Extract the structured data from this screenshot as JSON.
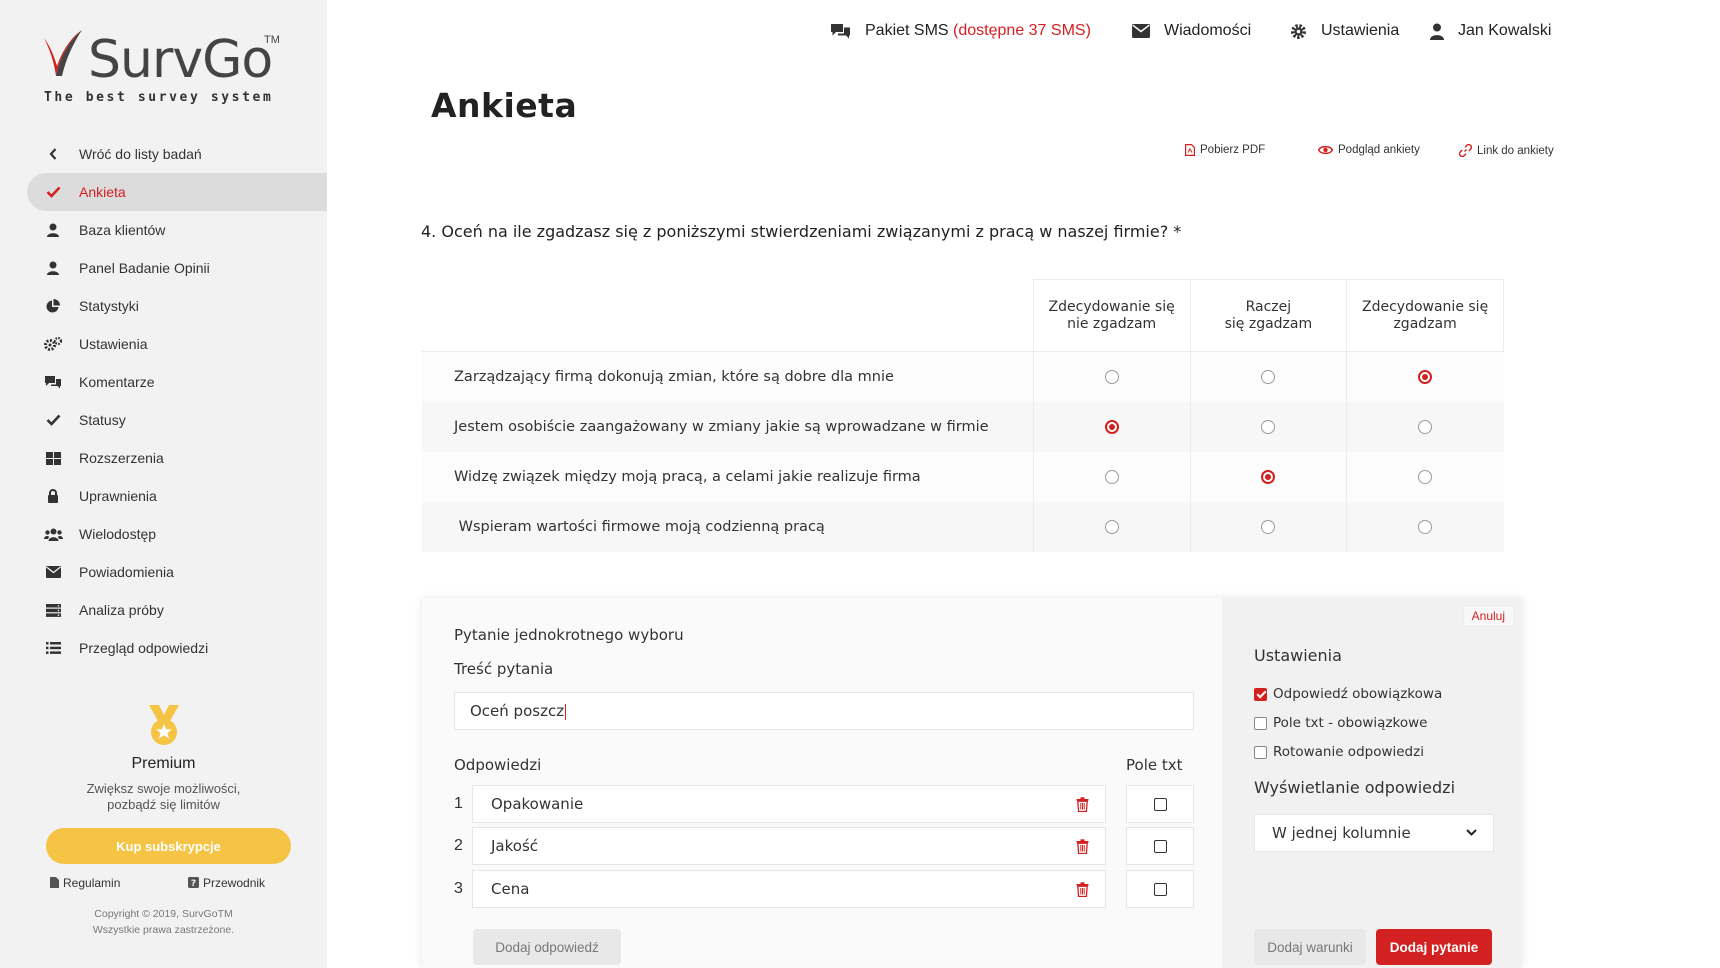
{
  "brand": {
    "name": "SurvGo",
    "tm": "TM",
    "tagline": "The best survey system",
    "accent": "#d32020",
    "yellow": "#f5c445"
  },
  "sidebar": {
    "items": [
      {
        "label": "Wróć do listy badań",
        "icon": "chevron-left-icon"
      },
      {
        "label": "Ankieta",
        "icon": "check-icon",
        "active": true
      },
      {
        "label": "Baza klientów",
        "icon": "user-icon"
      },
      {
        "label": "Panel Badanie Opinii",
        "icon": "user-icon"
      },
      {
        "label": "Statystyki",
        "icon": "pie-chart-icon"
      },
      {
        "label": "Ustawienia",
        "icon": "gears-icon"
      },
      {
        "label": "Komentarze",
        "icon": "comments-icon"
      },
      {
        "label": "Statusy",
        "icon": "check-icon"
      },
      {
        "label": "Rozszerzenia",
        "icon": "grid-icon"
      },
      {
        "label": "Uprawnienia",
        "icon": "lock-icon"
      },
      {
        "label": "Wielodostęp",
        "icon": "users-icon"
      },
      {
        "label": "Powiadomienia",
        "icon": "envelope-icon"
      },
      {
        "label": "Analiza próby",
        "icon": "server-icon"
      },
      {
        "label": "Przegląd odpowiedzi",
        "icon": "list-icon"
      }
    ],
    "premium": {
      "title": "Premium",
      "desc_line1": "Zwiększ swoje możliwości,",
      "desc_line2": "pozbądź się limitów",
      "button": "Kup subskrypcje"
    },
    "links": {
      "terms": "Regulamin",
      "guide": "Przewodnik"
    },
    "copyright_line1": "Copyright © 2019, SurvGoTM",
    "copyright_line2": "Wszystkie prawa zastrzeżone."
  },
  "topbar": {
    "sms_label": "Pakiet SMS",
    "sms_available": "(dostępne 37 SMS)",
    "messages": "Wiadomości",
    "settings": "Ustawienia",
    "user": "Jan Kowalski"
  },
  "page": {
    "title": "Ankieta",
    "actions": {
      "pdf": "Pobierz PDF",
      "preview": "Podgląd ankiety",
      "link": "Link do ankiety"
    }
  },
  "question": {
    "title": "4. Oceń na ile zgadzasz się z poniższymi stwierdzeniami związanymi z pracą w naszej firmie? *",
    "columns": [
      {
        "line1": "Zdecydowanie się",
        "line2": "nie zgadzam"
      },
      {
        "line1": "Raczej",
        "line2": "się zgadzam"
      },
      {
        "line1": "Zdecydowanie się",
        "line2": "zgadzam"
      }
    ],
    "rows": [
      {
        "text": "Zarządzający firmą dokonują zmian, które są dobre dla mnie",
        "selected": 2
      },
      {
        "text": "Jestem osobiście zaangażowany w zmiany jakie są wprowadzane w firmie",
        "selected": 0
      },
      {
        "text": "Widzę związek między moją pracą, a celami jakie realizuje firma",
        "selected": 1
      },
      {
        "text": " Wspieram wartości firmowe moją codzienną pracą",
        "selected": -1
      }
    ]
  },
  "editor": {
    "type": "Pytanie jednokrotnego wyboru",
    "content_label": "Treść pytania",
    "content_value": "Oceń poszcz",
    "answers_label": "Odpowiedzi",
    "pole_txt_label": "Pole txt",
    "answers": [
      {
        "num": "1",
        "value": "Opakowanie"
      },
      {
        "num": "2",
        "value": "Jakość"
      },
      {
        "num": "3",
        "value": "Cena"
      }
    ],
    "add_answer": "Dodaj odpowiedź",
    "cancel": "Anuluj",
    "settings_title": "Ustawienia",
    "options": [
      {
        "label": "Odpowiedź obowiązkowa",
        "checked": true
      },
      {
        "label": "Pole txt - obowiązkowe",
        "checked": false
      },
      {
        "label": "Rotowanie odpowiedzi",
        "checked": false
      }
    ],
    "display_title": "Wyświetlanie odpowiedzi",
    "display_value": "W jednej kolumnie",
    "add_conditions": "Dodaj warunki",
    "add_question": "Dodaj pytanie"
  }
}
